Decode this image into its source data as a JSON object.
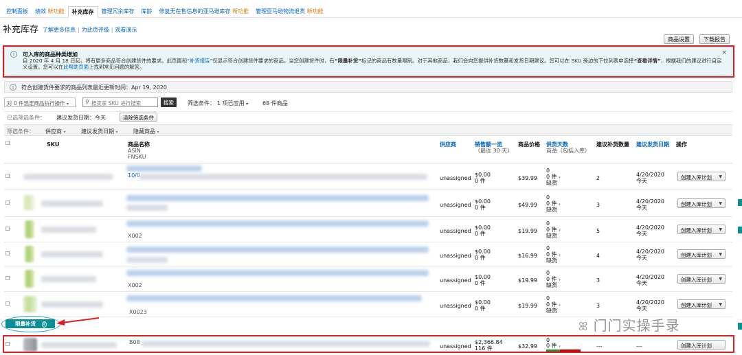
{
  "nav": {
    "tabs": [
      {
        "label": "控制面板",
        "badge": ""
      },
      {
        "label": "绩效",
        "badge": "新功能"
      },
      {
        "label": "补充库存",
        "badge": ""
      },
      {
        "label": "管理冗余库存",
        "badge": ""
      },
      {
        "label": "库龄",
        "badge": ""
      },
      {
        "label": "修复无在售信息的亚马逊库存",
        "badge": "新功能"
      },
      {
        "label": "管理亚马逊物流退货",
        "badge": "新功能"
      }
    ]
  },
  "page": {
    "title": "补充库存",
    "links": [
      "了解更多信息",
      "为此页评级",
      "观看演示"
    ],
    "product_settings": "商品设置",
    "download_report": "下载报告"
  },
  "banner": {
    "title": "可入库的商品种类增加",
    "body_1": "自 2020 年 4 月 18 日起，将有更多商品符合创建货件的要求。此页面和",
    "body_link": "“补货报告”",
    "body_2": "仅显示符合创建货件要求的商品。当您创建货件时，有",
    "body_bold": "“限量补货”",
    "body_3": "标记的商品有数量限制。对于其他商品，我们会向您提供补货数量和发货日期建议。您可以在 SKU 旁边的下拉列表中选择",
    "body_bold2": "“查看详情”",
    "body_4": "，根据我们的建议进行自定义设置。您可以在",
    "body_link2": "此帮助页面",
    "body_5": "上找到常见问题的解答。",
    "close": "×"
  },
  "update": {
    "text": "符合创建货件要求的商品列表最近更新时间：Apr 19, 2020"
  },
  "filters": {
    "bulk_action": "对 0 件选定商品执行操作",
    "search_placeholder": "按卖家 SKU 进行搜索",
    "search_button": "搜索",
    "filter_label": "筛选条件：",
    "filter_value": "1 项已应用",
    "count": "68 件商品",
    "applied_label": "已选筛选条件：",
    "applied_value": "建议发货日期：今天",
    "clear_button": "清除筛选条件",
    "cond_label": "筛选条件：",
    "cond_items": [
      "供应商",
      "建议发货日期",
      "隐藏商品"
    ]
  },
  "table": {
    "headers": {
      "sku": "SKU",
      "name": "商品名称",
      "name_sub1": "ASIN",
      "name_sub2": "FNSKU",
      "supplier": "供应商",
      "sales": "销售额一览",
      "sales_sub": "（最近 30 天）",
      "price": "商品价格",
      "days": "供货天数",
      "days_sub": "商品（包括入库）",
      "qty": "建议补货数量",
      "date": "建议发货日期",
      "action": "操作"
    },
    "rows": [
      {
        "fnsku_hint": "10/0",
        "supplier": "unassigned",
        "sales": "$0.00",
        "units": "0 件",
        "price": "$39.99",
        "days": "0",
        "stock": "0 件",
        "status": "缺货",
        "qty": "2",
        "date": "4/20/2020",
        "when": "今天",
        "action": "创建入库计划"
      },
      {
        "fnsku_hint": "",
        "supplier": "unassigned",
        "sales": "$0.00",
        "units": "0 件",
        "price": "$49.99",
        "days": "0",
        "stock": "0 件",
        "status": "缺货",
        "qty": "3",
        "date": "4/20/2020",
        "when": "今天",
        "action": "创建入库计划"
      },
      {
        "fnsku_hint": "X002",
        "supplier": "unassigned",
        "sales": "$0.00",
        "units": "0 件",
        "price": "$19.99",
        "days": "0",
        "stock": "0 件",
        "status": "缺货",
        "qty": "5",
        "date": "4/20/2020",
        "when": "今天",
        "action": "创建入库计划"
      },
      {
        "fnsku_hint": "",
        "supplier": "unassigned",
        "sales": "$0.00",
        "units": "0 件",
        "price": "$16.99",
        "days": "0",
        "stock": "0 件",
        "status": "缺货",
        "qty": "4",
        "date": "4/20/2020",
        "when": "今天",
        "action": "创建入库计划"
      },
      {
        "fnsku_hint": "X002",
        "supplier": "unassigned",
        "sales": "$0.00",
        "units": "0 件",
        "price": "$19.99",
        "days": "0",
        "stock": "0 件",
        "status": "缺货",
        "qty": "3",
        "date": "4/20/2020",
        "when": "今天",
        "action": "创建入库计划"
      },
      {
        "fnsku_hint": "X0023",
        "supplier": "unassigned",
        "sales": "$0.00",
        "units": "0 件",
        "price": "$19.99",
        "days": "0",
        "stock": "0 件",
        "status": "缺货",
        "qty": "3",
        "date": "4/20/2020",
        "when": "今天",
        "action": "创建入库计划"
      }
    ],
    "limited_badge": "限量补货",
    "last_row": {
      "fnsku_hint": "B08",
      "supplier": "unassigned",
      "sales": "$2,366.84",
      "units": "116 件",
      "price": "$32.99",
      "days": "0",
      "stock": "0 件",
      "qty": "---",
      "date": "---",
      "action": "创建入库计划"
    }
  },
  "watermark": "门门实操手录",
  "colors": {
    "link": "#0066c0",
    "orange": "#e47911",
    "red": "#c40000",
    "teal": "#0a8f96",
    "annotation_red": "#e01e1e"
  }
}
